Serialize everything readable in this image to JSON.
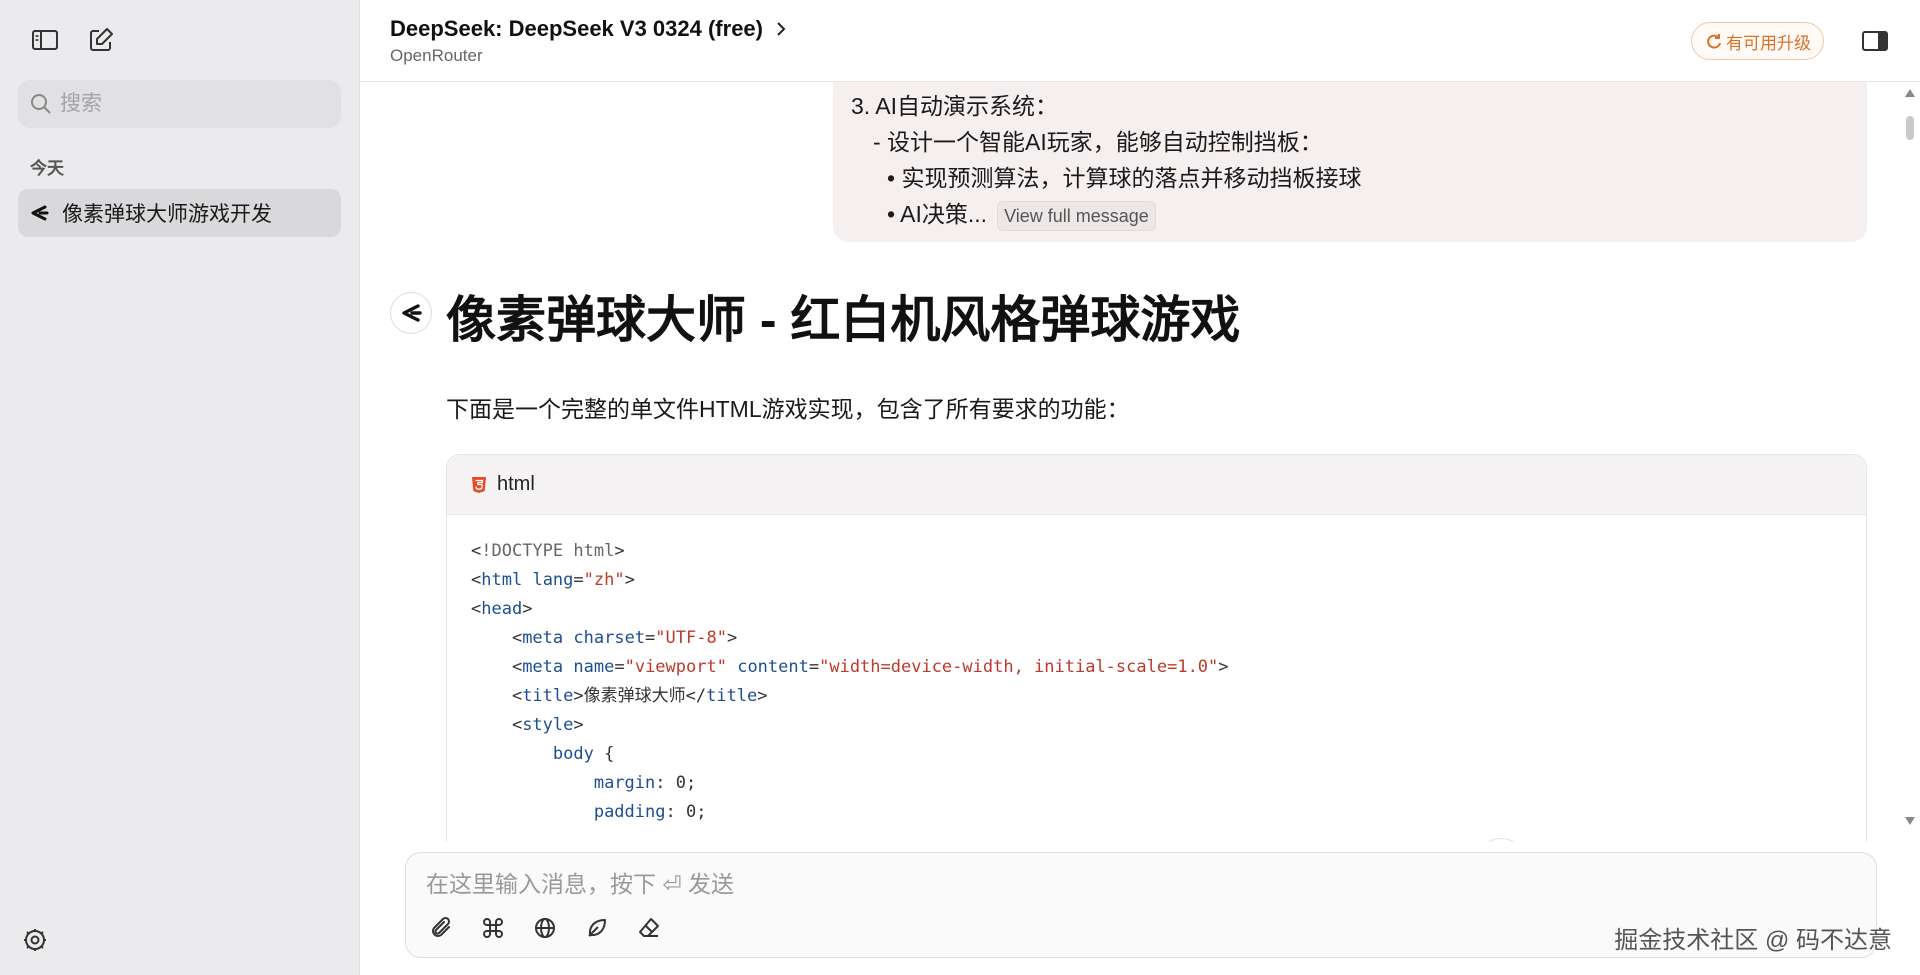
{
  "sidebar": {
    "search_placeholder": "搜索",
    "section_today": "今天",
    "conversations": [
      {
        "title": "像素弹球大师游戏开发"
      }
    ]
  },
  "header": {
    "model_title": "DeepSeek: DeepSeek V3 0324 (free)",
    "provider": "OpenRouter",
    "upgrade_label": "有可用升级"
  },
  "user_message": {
    "line1": "3. AI自动演示系统：",
    "line2": "- 设计一个智能AI玩家，能够自动控制挡板：",
    "line3": "• 实现预测算法，计算球的落点并移动挡板接球",
    "line4": "• AI决策...",
    "view_full": "View full message"
  },
  "answer": {
    "title": "像素弹球大师 - 红白机风格弹球游戏",
    "intro": "下面是一个完整的单文件HTML游戏实现，包含了所有要求的功能："
  },
  "code": {
    "language": "html",
    "lines": [
      [
        {
          "t": "<",
          "c": "punc"
        },
        {
          "t": "!DOCTYPE html",
          "c": "doc"
        },
        {
          "t": ">",
          "c": "punc"
        }
      ],
      [
        {
          "t": "<",
          "c": "punc"
        },
        {
          "t": "html",
          "c": "tag"
        },
        {
          "t": " ",
          "c": "punc"
        },
        {
          "t": "lang",
          "c": "attr"
        },
        {
          "t": "=",
          "c": "punc"
        },
        {
          "t": "\"zh\"",
          "c": "str"
        },
        {
          "t": ">",
          "c": "punc"
        }
      ],
      [
        {
          "t": "<",
          "c": "punc"
        },
        {
          "t": "head",
          "c": "tag"
        },
        {
          "t": ">",
          "c": "punc"
        }
      ],
      [
        {
          "t": "    <",
          "c": "punc"
        },
        {
          "t": "meta",
          "c": "tag"
        },
        {
          "t": " ",
          "c": "punc"
        },
        {
          "t": "charset",
          "c": "attr"
        },
        {
          "t": "=",
          "c": "punc"
        },
        {
          "t": "\"UTF-8\"",
          "c": "str"
        },
        {
          "t": ">",
          "c": "punc"
        }
      ],
      [
        {
          "t": "    <",
          "c": "punc"
        },
        {
          "t": "meta",
          "c": "tag"
        },
        {
          "t": " ",
          "c": "punc"
        },
        {
          "t": "name",
          "c": "attr"
        },
        {
          "t": "=",
          "c": "punc"
        },
        {
          "t": "\"viewport\"",
          "c": "str"
        },
        {
          "t": " ",
          "c": "punc"
        },
        {
          "t": "content",
          "c": "attr"
        },
        {
          "t": "=",
          "c": "punc"
        },
        {
          "t": "\"width=device-width, initial-scale=1.0\"",
          "c": "str"
        },
        {
          "t": ">",
          "c": "punc"
        }
      ],
      [
        {
          "t": "    <",
          "c": "punc"
        },
        {
          "t": "title",
          "c": "tag"
        },
        {
          "t": ">像素弹球大师</",
          "c": "punc"
        },
        {
          "t": "title",
          "c": "tag"
        },
        {
          "t": ">",
          "c": "punc"
        }
      ],
      [
        {
          "t": "    <",
          "c": "punc"
        },
        {
          "t": "style",
          "c": "tag"
        },
        {
          "t": ">",
          "c": "punc"
        }
      ],
      [
        {
          "t": "        ",
          "c": "punc"
        },
        {
          "t": "body",
          "c": "sel"
        },
        {
          "t": " {",
          "c": "punc"
        }
      ],
      [
        {
          "t": "            ",
          "c": "punc"
        },
        {
          "t": "margin",
          "c": "prop"
        },
        {
          "t": ": 0;",
          "c": "punc"
        }
      ],
      [
        {
          "t": "            ",
          "c": "punc"
        },
        {
          "t": "padding",
          "c": "prop"
        },
        {
          "t": ": 0;",
          "c": "punc"
        }
      ]
    ]
  },
  "composer": {
    "placeholder": "在这里输入消息，按下 ⏎ 发送"
  },
  "watermark": "掘金技术社区 @ 码不达意",
  "colors": {
    "accent_upgrade": "#d9732c",
    "sidebar_bg": "#ebebed",
    "user_bubble_bg": "#f5efef"
  }
}
